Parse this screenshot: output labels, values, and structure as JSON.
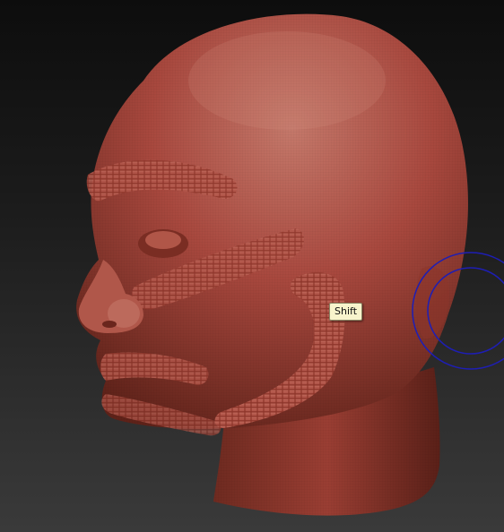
{
  "viewport": {
    "background_top": "#0d0d0d",
    "background_bottom": "#3a3a3a"
  },
  "model": {
    "type": "sculpted-head-mesh",
    "material_color": "#a8483e",
    "highlight_color": "#c4786a",
    "shadow_color": "#5e2219"
  },
  "tooltip": {
    "label": "Shift"
  },
  "brush_cursor": {
    "color": "#1e1eb4",
    "shape": "double-circle"
  }
}
